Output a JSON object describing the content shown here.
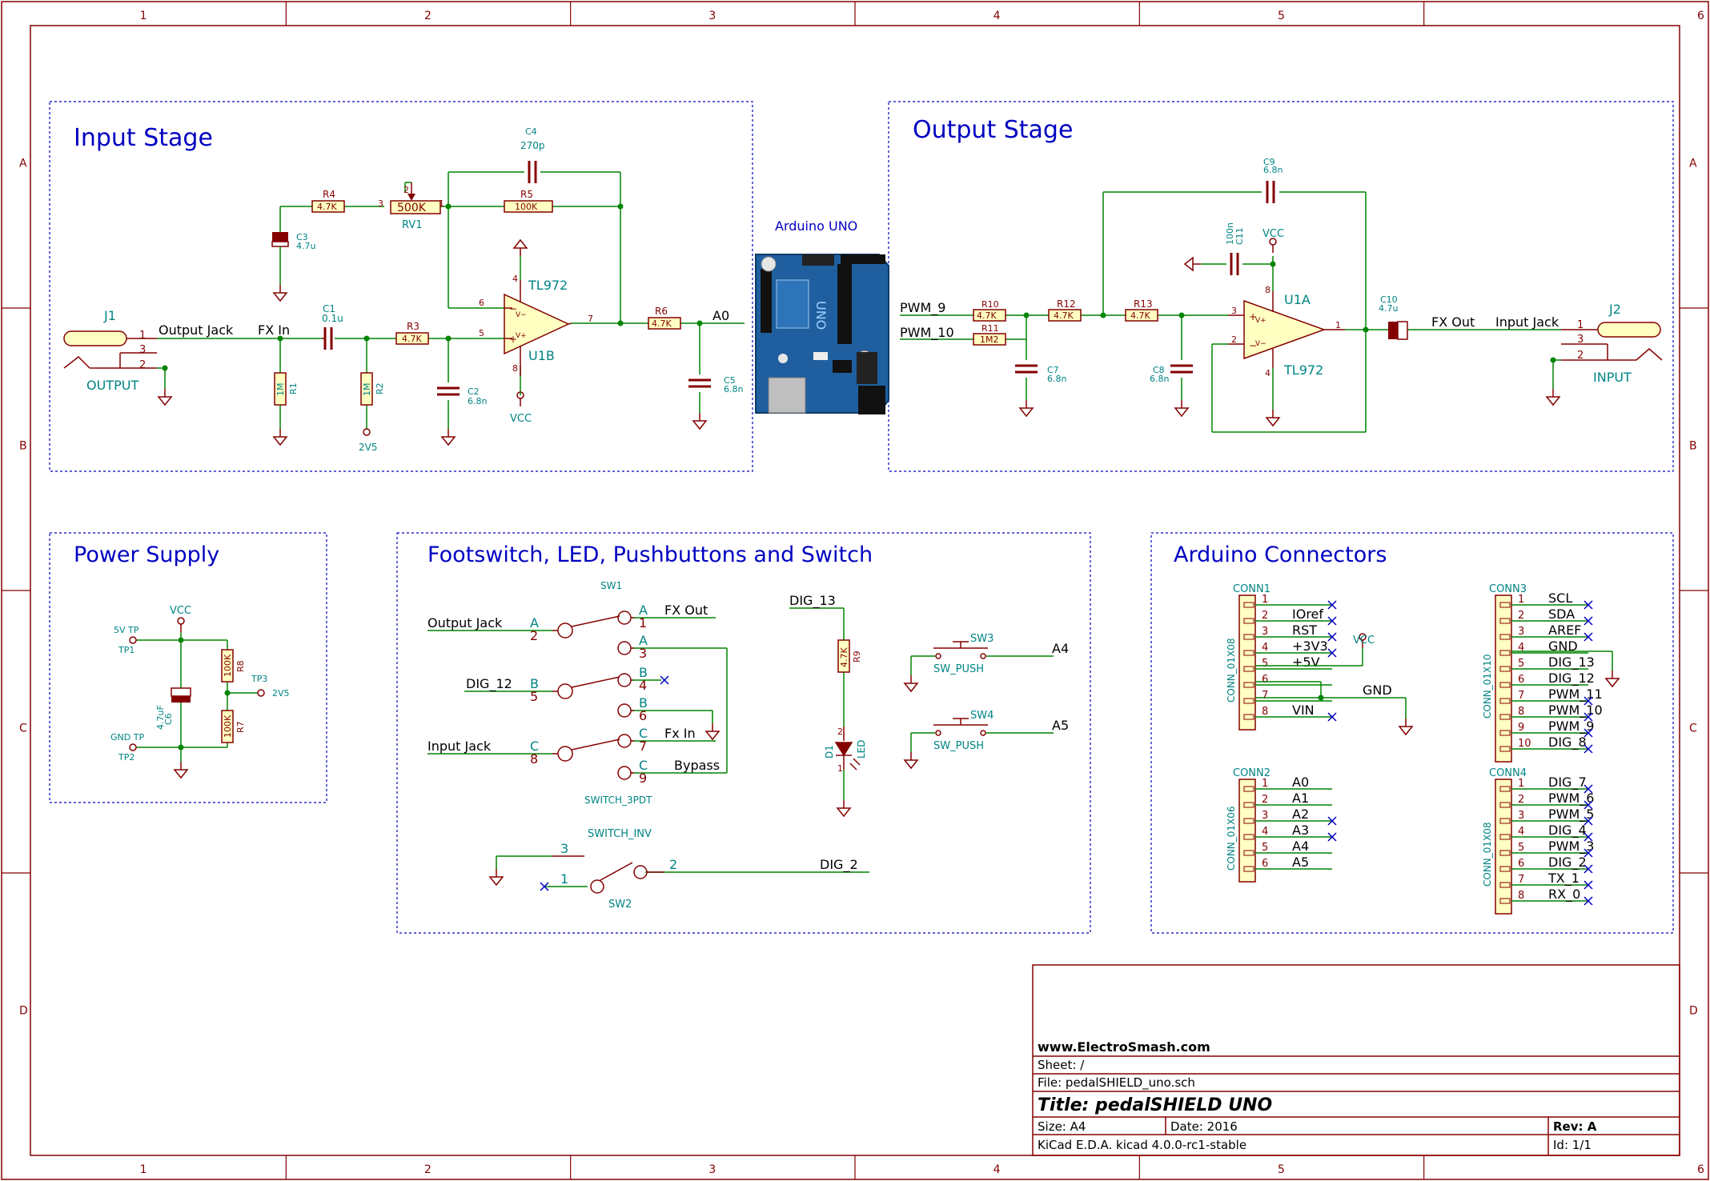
{
  "colors": {
    "frame": "#840000",
    "wire": "#008400",
    "component": "#840000",
    "fill": "#ffffc2",
    "text": "#000000",
    "ref": "#008484",
    "section": "#0000c2",
    "noconnect": "#0000c2"
  },
  "frame": {
    "columns": [
      "1",
      "2",
      "3",
      "4",
      "5",
      "6"
    ],
    "rows": [
      "A",
      "B",
      "C",
      "D"
    ]
  },
  "sections": {
    "input_stage": "Input Stage",
    "output_stage": "Output Stage",
    "power_supply": "Power Supply",
    "footswitch": "Footswitch, LED, Pushbuttons and Switch",
    "arduino_connectors": "Arduino Connectors"
  },
  "arduino": {
    "label": "Arduino UNO"
  },
  "input_stage": {
    "j1_ref": "J1",
    "j1_name": "OUTPUT",
    "j1_pins": [
      "1",
      "3",
      "2"
    ],
    "output_jack_net": "Output Jack",
    "fx_in_net": "FX In",
    "a0_net": "A0",
    "c1_ref": "C1",
    "c1_val": "0.1u",
    "r1_ref": "R1",
    "r1_val": "1M",
    "r2_ref": "R2",
    "r2_val": "1M",
    "v2v5": "2V5",
    "r3_ref": "R3",
    "r3_val": "4.7K",
    "c2_ref": "C2",
    "c2_val": "6.8n",
    "r4_ref": "R4",
    "r4_val": "4.7K",
    "c3_ref": "C3",
    "c3_val": "4.7u",
    "rv1_ref": "RV1",
    "rv1_val": "500K",
    "rv1_pins": [
      "3",
      "2",
      "1"
    ],
    "r5_ref": "R5",
    "r5_val": "100K",
    "c4_ref": "C4",
    "c4_val": "270p",
    "u1b_ref": "U1B",
    "u1b_val": "TL972",
    "u1b_pins": [
      "4",
      "6",
      "5",
      "7",
      "8"
    ],
    "vcc": "VCC",
    "r6_ref": "R6",
    "r6_val": "4.7K",
    "c5_ref": "C5",
    "c5_val": "6.8n"
  },
  "output_stage": {
    "pwm9_net": "PWM_9",
    "pwm10_net": "PWM_10",
    "r10_ref": "R10",
    "r10_val": "4.7K",
    "r11_ref": "R11",
    "r11_val": "1M2",
    "c7_ref": "C7",
    "c7_val": "6.8n",
    "r12_ref": "R12",
    "r12_val": "4.7K",
    "r13_ref": "R13",
    "r13_val": "4.7K",
    "c8_ref": "C8",
    "c8_val": "6.8n",
    "c9_ref": "C9",
    "c9_val": "6.8n",
    "c11_ref": "C11",
    "c11_val": "100n",
    "vcc": "VCC",
    "u1a_ref": "U1A",
    "u1a_val": "TL972",
    "u1a_pins": [
      "8",
      "3",
      "2",
      "4",
      "1"
    ],
    "c10_ref": "C10",
    "c10_val": "4.7u",
    "fx_out_net": "FX Out",
    "input_jack_net": "Input Jack",
    "j2_ref": "J2",
    "j2_name": "INPUT",
    "j2_pins": [
      "1",
      "3",
      "2"
    ]
  },
  "power_supply": {
    "vcc": "VCC",
    "tp1_label": "5V TP",
    "tp1_ref": "TP1",
    "tp2_label": "GND TP",
    "tp2_ref": "TP2",
    "tp3_ref": "TP3",
    "tp3_net": "2V5",
    "r8_ref": "R8",
    "r8_val": "100K",
    "r7_ref": "R7",
    "r7_val": "100K",
    "c6_ref": "C6",
    "c6_val": "4.7uF"
  },
  "footswitch": {
    "sw1_ref": "SW1",
    "sw1_val": "SWITCH_3PDT",
    "output_jack_net": "Output Jack",
    "dig12_net": "DIG_12",
    "input_jack_net": "Input Jack",
    "pole_letters": [
      "A",
      "B",
      "C"
    ],
    "pole_pins": [
      "2",
      "5",
      "8"
    ],
    "throws": [
      {
        "letter": "A",
        "pin": "1",
        "net": "FX Out"
      },
      {
        "letter": "A",
        "pin": "3",
        "net": ""
      },
      {
        "letter": "B",
        "pin": "4",
        "net": ""
      },
      {
        "letter": "B",
        "pin": "6",
        "net": ""
      },
      {
        "letter": "C",
        "pin": "7",
        "net": "Fx In"
      },
      {
        "letter": "C",
        "pin": "9",
        "net": "Bypass"
      }
    ],
    "dig13_net": "DIG_13",
    "r9_ref": "R9",
    "r9_val": "4.7K",
    "d1_ref": "D1",
    "d1_val": "LED",
    "d1_pins": [
      "2",
      "1"
    ],
    "sw3_ref": "SW3",
    "sw3_val": "SW_PUSH",
    "a4_net": "A4",
    "sw4_ref": "SW4",
    "sw4_val": "SW_PUSH",
    "a5_net": "A5",
    "sw2_ref": "SW2",
    "sw2_val": "SWITCH_INV",
    "sw2_pins": [
      "3",
      "1",
      "2"
    ],
    "dig2_net": "DIG_2"
  },
  "connectors": {
    "conn1": {
      "ref": "CONN1",
      "val": "CONN_01X08",
      "pins": [
        "1",
        "2",
        "3",
        "4",
        "5",
        "6",
        "7",
        "8"
      ],
      "nets": [
        "",
        "IOref",
        "RST",
        "+3V3",
        "+5V",
        "",
        "",
        "VIN"
      ],
      "vcc": "VCC",
      "gnd": "GND"
    },
    "conn2": {
      "ref": "CONN2",
      "val": "CONN_01X06",
      "pins": [
        "1",
        "2",
        "3",
        "4",
        "5",
        "6"
      ],
      "nets": [
        "A0",
        "A1",
        "A2",
        "A3",
        "A4",
        "A5"
      ]
    },
    "conn3": {
      "ref": "CONN3",
      "val": "CONN_01X10",
      "pins": [
        "1",
        "2",
        "3",
        "4",
        "5",
        "6",
        "7",
        "8",
        "9",
        "10"
      ],
      "nets": [
        "SCL",
        "SDA",
        "AREF",
        "GND",
        "DIG_13",
        "DIG_12",
        "PWM_11",
        "PWM_10",
        "PWM_9",
        "DIG_8"
      ]
    },
    "conn4": {
      "ref": "CONN4",
      "val": "CONN_01X08",
      "pins": [
        "1",
        "2",
        "3",
        "4",
        "5",
        "6",
        "7",
        "8"
      ],
      "nets": [
        "DIG_7",
        "PWM_6",
        "PWM_5",
        "DIG_4",
        "PWM_3",
        "DIG_2",
        "TX_1",
        "RX_0"
      ]
    }
  },
  "title_block": {
    "company": "www.ElectroSmash.com",
    "sheet": "Sheet: /",
    "file": "File: pedalSHIELD_uno.sch",
    "title": "Title: pedalSHIELD UNO",
    "size": "Size: A4",
    "date": "Date: 2016",
    "rev": "Rev: A",
    "tool": "KiCad E.D.A.  kicad 4.0.0-rc1-stable",
    "id": "Id: 1/1"
  }
}
